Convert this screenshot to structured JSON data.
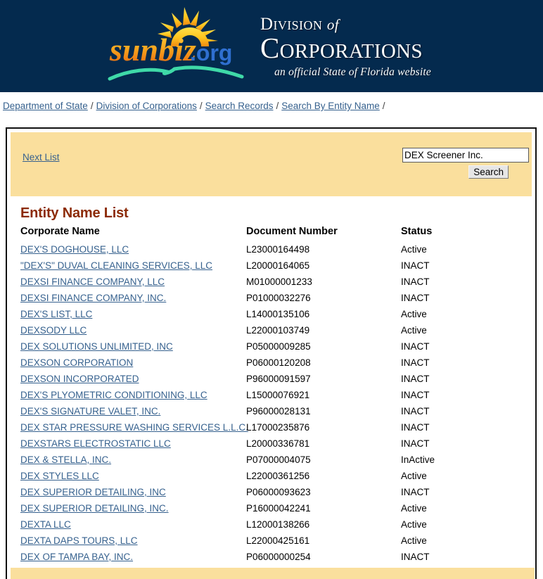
{
  "header": {
    "logo_text": "sunbiz",
    "logo_suffix": ".org",
    "division": "Division",
    "division_of": "of",
    "corporations": "Corporations",
    "tagline": "an official State of Florida website",
    "bg_color": "#042a4e"
  },
  "breadcrumb": {
    "items": [
      "Department of State",
      "Division of Corporations",
      "Search Records",
      "Search By Entity Name"
    ],
    "separator": "/",
    "trailing_separator": "/"
  },
  "search_panel": {
    "next_list_label": "Next List",
    "input_value": "DEX Screener Inc.",
    "input_placeholder": "",
    "search_button_label": "Search",
    "bg_color": "#fadf9d"
  },
  "results": {
    "title": "Entity Name List",
    "title_color": "#8c2a06",
    "columns": [
      "Corporate Name",
      "Document Number",
      "Status"
    ],
    "rows": [
      {
        "name": "DEX'S DOGHOUSE, LLC",
        "doc": "L23000164498",
        "status": "Active"
      },
      {
        "name": "\"DEX'S\" DUVAL CLEANING SERVICES, LLC",
        "doc": "L20000164065",
        "status": "INACT"
      },
      {
        "name": "DEXSI FINANCE COMPANY, LLC",
        "doc": "M01000001233",
        "status": "INACT"
      },
      {
        "name": "DEXSI FINANCE COMPANY, INC.",
        "doc": "P01000032276",
        "status": "INACT"
      },
      {
        "name": "DEX'S LIST, LLC",
        "doc": "L14000135106",
        "status": "Active"
      },
      {
        "name": "DEXSODY LLC",
        "doc": "L22000103749",
        "status": "Active"
      },
      {
        "name": "DEX SOLUTIONS UNLIMITED, INC",
        "doc": "P05000009285",
        "status": "INACT"
      },
      {
        "name": "DEXSON CORPORATION",
        "doc": "P06000120208",
        "status": "INACT"
      },
      {
        "name": "DEXSON INCORPORATED",
        "doc": "P96000091597",
        "status": "INACT"
      },
      {
        "name": "DEX'S PLYOMETRIC CONDITIONING, LLC",
        "doc": "L15000076921",
        "status": "INACT"
      },
      {
        "name": "DEX'S SIGNATURE VALET, INC.",
        "doc": "P96000028131",
        "status": "INACT"
      },
      {
        "name": "DEX STAR PRESSURE WASHING SERVICES L.L.C.",
        "doc": "L17000235876",
        "status": "INACT"
      },
      {
        "name": "DEXSTARS ELECTROSTATIC LLC",
        "doc": "L20000336781",
        "status": "INACT"
      },
      {
        "name": "DEX & STELLA, INC.",
        "doc": "P07000004075",
        "status": "InActive"
      },
      {
        "name": "DEX STYLES LLC",
        "doc": "L22000361256",
        "status": "Active"
      },
      {
        "name": "DEX SUPERIOR DETAILING, INC",
        "doc": "P06000093623",
        "status": "INACT"
      },
      {
        "name": "DEX SUPERIOR DETAILING, INC.",
        "doc": "P16000042241",
        "status": "Active"
      },
      {
        "name": "DEXTA LLC",
        "doc": "L12000138266",
        "status": "Active"
      },
      {
        "name": "DEXTA DAPS TOURS, LLC",
        "doc": "L22000425161",
        "status": "Active"
      },
      {
        "name": "DEX OF TAMPA BAY, INC.",
        "doc": "P06000000254",
        "status": "INACT"
      }
    ]
  }
}
